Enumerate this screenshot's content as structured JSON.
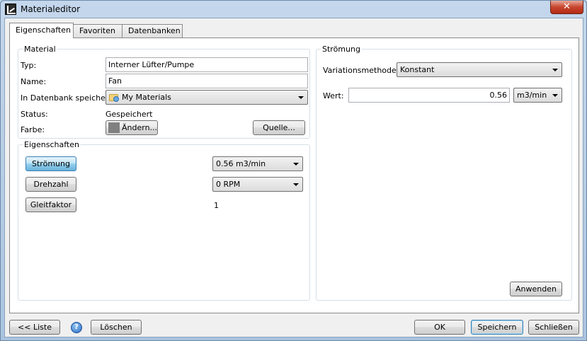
{
  "window": {
    "title": "Materialeditor",
    "close_glyph": "✕"
  },
  "tabs": [
    {
      "label": "Eigenschaften",
      "active": true
    },
    {
      "label": "Favoriten",
      "active": false
    },
    {
      "label": "Datenbanken",
      "active": false
    }
  ],
  "material": {
    "group_title": "Material",
    "typ_label": "Typ:",
    "typ_value": "Interner Lüfter/Pumpe",
    "name_label": "Name:",
    "name_value": "Fan",
    "db_label": "In Datenbank speichern:",
    "db_value": "My Materials",
    "status_label": "Status:",
    "status_value": "Gespeichert",
    "farbe_label": "Farbe:",
    "aendern_label": "Ändern...",
    "quelle_label": "Quelle...",
    "swatch_color": "#808080"
  },
  "eigenschaften": {
    "group_title": "Eigenschaften",
    "rows": [
      {
        "button": "Strömung",
        "selected": true,
        "value": "0.56 m3/min",
        "kind": "combo"
      },
      {
        "button": "Drehzahl",
        "selected": false,
        "value": "0 RPM",
        "kind": "combo"
      },
      {
        "button": "Gleitfaktor",
        "selected": false,
        "value": "1",
        "kind": "text"
      }
    ]
  },
  "stroemung": {
    "group_title": "Strömung",
    "variation_label": "Variationsmethode:",
    "variation_value": "Konstant",
    "wert_label": "Wert:",
    "wert_value": "0.56",
    "unit_value": "m3/min",
    "apply_label": "Anwenden"
  },
  "footer": {
    "list_label": "<< Liste",
    "help_glyph": "?",
    "delete_label": "Löschen",
    "ok_label": "OK",
    "save_label": "Speichern",
    "close_label": "Schließen"
  },
  "colors": {
    "accent": "#3c7fb1",
    "close_red": "#c7452e"
  }
}
